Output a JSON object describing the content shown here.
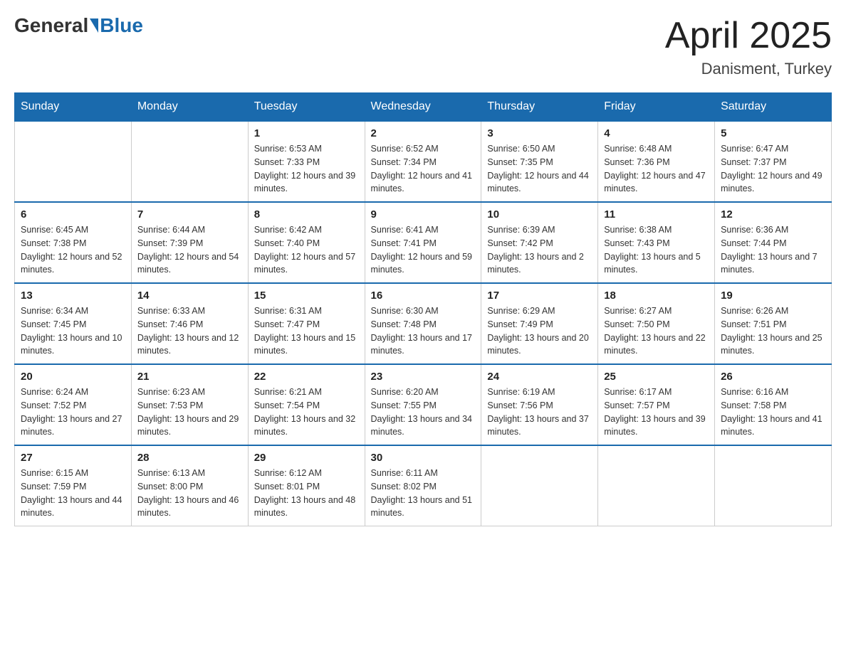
{
  "header": {
    "logo_general": "General",
    "logo_blue": "Blue",
    "month_title": "April 2025",
    "location": "Danisment, Turkey"
  },
  "weekdays": [
    "Sunday",
    "Monday",
    "Tuesday",
    "Wednesday",
    "Thursday",
    "Friday",
    "Saturday"
  ],
  "weeks": [
    [
      {
        "day": "",
        "sunrise": "",
        "sunset": "",
        "daylight": "",
        "empty": true
      },
      {
        "day": "",
        "sunrise": "",
        "sunset": "",
        "daylight": "",
        "empty": true
      },
      {
        "day": "1",
        "sunrise": "Sunrise: 6:53 AM",
        "sunset": "Sunset: 7:33 PM",
        "daylight": "Daylight: 12 hours and 39 minutes."
      },
      {
        "day": "2",
        "sunrise": "Sunrise: 6:52 AM",
        "sunset": "Sunset: 7:34 PM",
        "daylight": "Daylight: 12 hours and 41 minutes."
      },
      {
        "day": "3",
        "sunrise": "Sunrise: 6:50 AM",
        "sunset": "Sunset: 7:35 PM",
        "daylight": "Daylight: 12 hours and 44 minutes."
      },
      {
        "day": "4",
        "sunrise": "Sunrise: 6:48 AM",
        "sunset": "Sunset: 7:36 PM",
        "daylight": "Daylight: 12 hours and 47 minutes."
      },
      {
        "day": "5",
        "sunrise": "Sunrise: 6:47 AM",
        "sunset": "Sunset: 7:37 PM",
        "daylight": "Daylight: 12 hours and 49 minutes."
      }
    ],
    [
      {
        "day": "6",
        "sunrise": "Sunrise: 6:45 AM",
        "sunset": "Sunset: 7:38 PM",
        "daylight": "Daylight: 12 hours and 52 minutes."
      },
      {
        "day": "7",
        "sunrise": "Sunrise: 6:44 AM",
        "sunset": "Sunset: 7:39 PM",
        "daylight": "Daylight: 12 hours and 54 minutes."
      },
      {
        "day": "8",
        "sunrise": "Sunrise: 6:42 AM",
        "sunset": "Sunset: 7:40 PM",
        "daylight": "Daylight: 12 hours and 57 minutes."
      },
      {
        "day": "9",
        "sunrise": "Sunrise: 6:41 AM",
        "sunset": "Sunset: 7:41 PM",
        "daylight": "Daylight: 12 hours and 59 minutes."
      },
      {
        "day": "10",
        "sunrise": "Sunrise: 6:39 AM",
        "sunset": "Sunset: 7:42 PM",
        "daylight": "Daylight: 13 hours and 2 minutes."
      },
      {
        "day": "11",
        "sunrise": "Sunrise: 6:38 AM",
        "sunset": "Sunset: 7:43 PM",
        "daylight": "Daylight: 13 hours and 5 minutes."
      },
      {
        "day": "12",
        "sunrise": "Sunrise: 6:36 AM",
        "sunset": "Sunset: 7:44 PM",
        "daylight": "Daylight: 13 hours and 7 minutes."
      }
    ],
    [
      {
        "day": "13",
        "sunrise": "Sunrise: 6:34 AM",
        "sunset": "Sunset: 7:45 PM",
        "daylight": "Daylight: 13 hours and 10 minutes."
      },
      {
        "day": "14",
        "sunrise": "Sunrise: 6:33 AM",
        "sunset": "Sunset: 7:46 PM",
        "daylight": "Daylight: 13 hours and 12 minutes."
      },
      {
        "day": "15",
        "sunrise": "Sunrise: 6:31 AM",
        "sunset": "Sunset: 7:47 PM",
        "daylight": "Daylight: 13 hours and 15 minutes."
      },
      {
        "day": "16",
        "sunrise": "Sunrise: 6:30 AM",
        "sunset": "Sunset: 7:48 PM",
        "daylight": "Daylight: 13 hours and 17 minutes."
      },
      {
        "day": "17",
        "sunrise": "Sunrise: 6:29 AM",
        "sunset": "Sunset: 7:49 PM",
        "daylight": "Daylight: 13 hours and 20 minutes."
      },
      {
        "day": "18",
        "sunrise": "Sunrise: 6:27 AM",
        "sunset": "Sunset: 7:50 PM",
        "daylight": "Daylight: 13 hours and 22 minutes."
      },
      {
        "day": "19",
        "sunrise": "Sunrise: 6:26 AM",
        "sunset": "Sunset: 7:51 PM",
        "daylight": "Daylight: 13 hours and 25 minutes."
      }
    ],
    [
      {
        "day": "20",
        "sunrise": "Sunrise: 6:24 AM",
        "sunset": "Sunset: 7:52 PM",
        "daylight": "Daylight: 13 hours and 27 minutes."
      },
      {
        "day": "21",
        "sunrise": "Sunrise: 6:23 AM",
        "sunset": "Sunset: 7:53 PM",
        "daylight": "Daylight: 13 hours and 29 minutes."
      },
      {
        "day": "22",
        "sunrise": "Sunrise: 6:21 AM",
        "sunset": "Sunset: 7:54 PM",
        "daylight": "Daylight: 13 hours and 32 minutes."
      },
      {
        "day": "23",
        "sunrise": "Sunrise: 6:20 AM",
        "sunset": "Sunset: 7:55 PM",
        "daylight": "Daylight: 13 hours and 34 minutes."
      },
      {
        "day": "24",
        "sunrise": "Sunrise: 6:19 AM",
        "sunset": "Sunset: 7:56 PM",
        "daylight": "Daylight: 13 hours and 37 minutes."
      },
      {
        "day": "25",
        "sunrise": "Sunrise: 6:17 AM",
        "sunset": "Sunset: 7:57 PM",
        "daylight": "Daylight: 13 hours and 39 minutes."
      },
      {
        "day": "26",
        "sunrise": "Sunrise: 6:16 AM",
        "sunset": "Sunset: 7:58 PM",
        "daylight": "Daylight: 13 hours and 41 minutes."
      }
    ],
    [
      {
        "day": "27",
        "sunrise": "Sunrise: 6:15 AM",
        "sunset": "Sunset: 7:59 PM",
        "daylight": "Daylight: 13 hours and 44 minutes."
      },
      {
        "day": "28",
        "sunrise": "Sunrise: 6:13 AM",
        "sunset": "Sunset: 8:00 PM",
        "daylight": "Daylight: 13 hours and 46 minutes."
      },
      {
        "day": "29",
        "sunrise": "Sunrise: 6:12 AM",
        "sunset": "Sunset: 8:01 PM",
        "daylight": "Daylight: 13 hours and 48 minutes."
      },
      {
        "day": "30",
        "sunrise": "Sunrise: 6:11 AM",
        "sunset": "Sunset: 8:02 PM",
        "daylight": "Daylight: 13 hours and 51 minutes."
      },
      {
        "day": "",
        "sunrise": "",
        "sunset": "",
        "daylight": "",
        "empty": true
      },
      {
        "day": "",
        "sunrise": "",
        "sunset": "",
        "daylight": "",
        "empty": true
      },
      {
        "day": "",
        "sunrise": "",
        "sunset": "",
        "daylight": "",
        "empty": true
      }
    ]
  ]
}
